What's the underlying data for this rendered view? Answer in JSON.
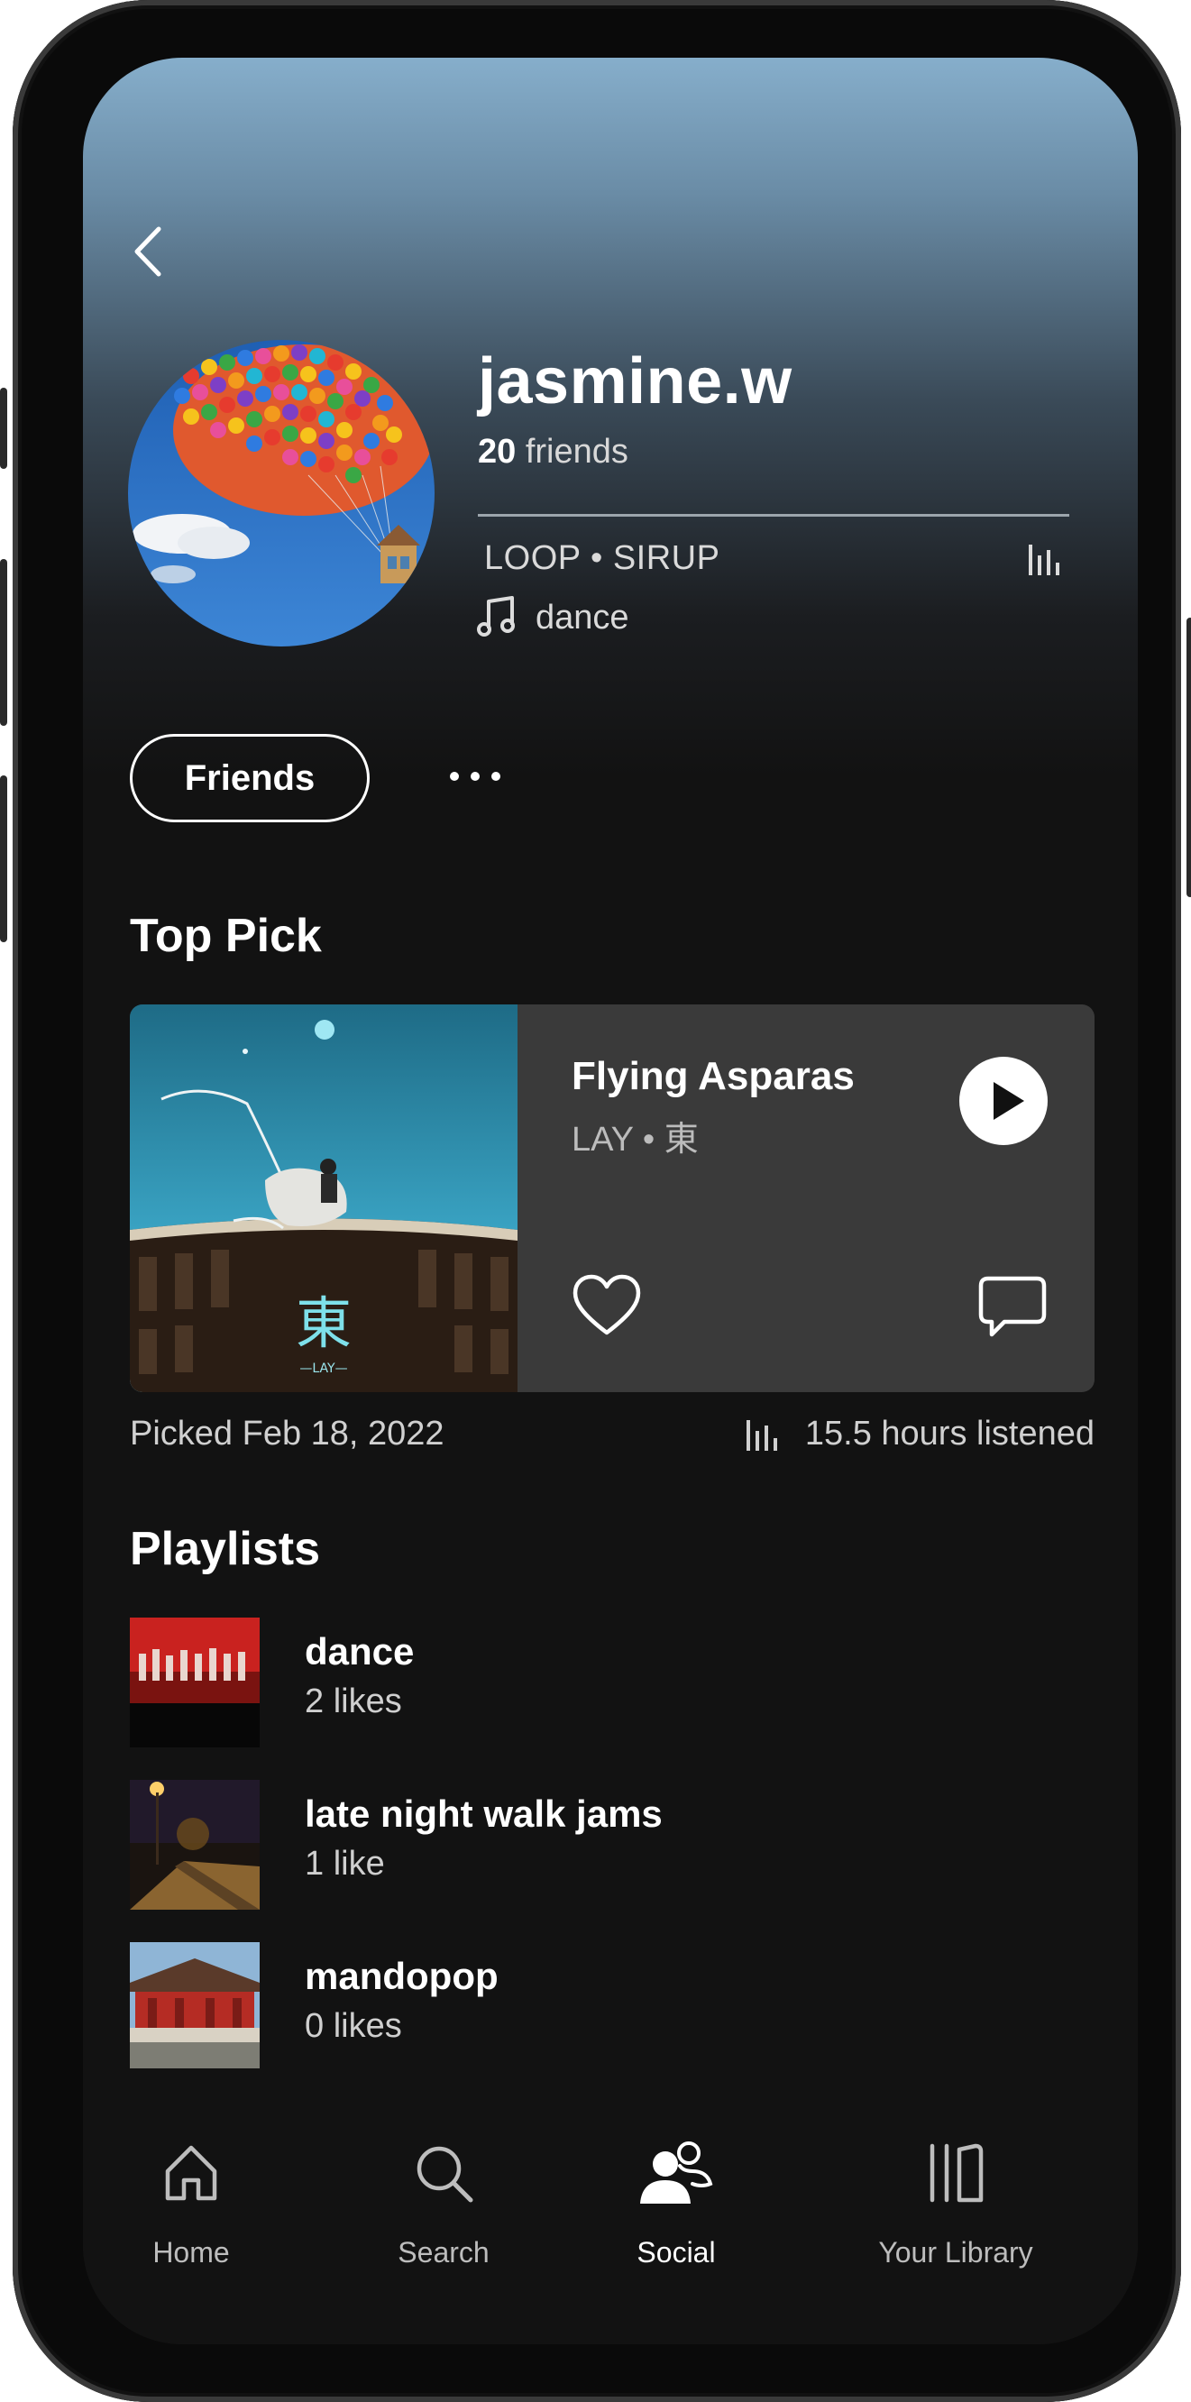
{
  "profile": {
    "username": "jasmine.w",
    "friends_number": "20",
    "friends_word": "friends",
    "now_playing": "LOOP • SIRUP",
    "genre": "dance"
  },
  "actions": {
    "friends_button": "Friends",
    "more_icon": "more-horizontal-icon"
  },
  "top_pick": {
    "section_title": "Top Pick",
    "title": "Flying Asparas",
    "artist": "LAY • 東",
    "album_glyph": "東",
    "album_small_text": "—LAY—",
    "picked_label": "Picked Feb 18, 2022",
    "listened_label": "15.5 hours listened"
  },
  "playlists": {
    "section_title": "Playlists",
    "items": [
      {
        "name": "dance",
        "likes": "2 likes"
      },
      {
        "name": "late night walk jams",
        "likes": "1 like"
      },
      {
        "name": "mandopop",
        "likes": "0 likes"
      }
    ]
  },
  "tabbar": {
    "items": [
      {
        "label": "Home",
        "icon": "home-icon",
        "active": false
      },
      {
        "label": "Search",
        "icon": "search-icon",
        "active": false
      },
      {
        "label": "Social",
        "icon": "social-icon",
        "active": true
      },
      {
        "label": "Your Library",
        "icon": "library-icon",
        "active": false
      }
    ]
  },
  "colors": {
    "header_top": "#86aecb",
    "background": "#121212",
    "card": "#3a3a3a",
    "text_secondary": "#d0d0d0"
  }
}
